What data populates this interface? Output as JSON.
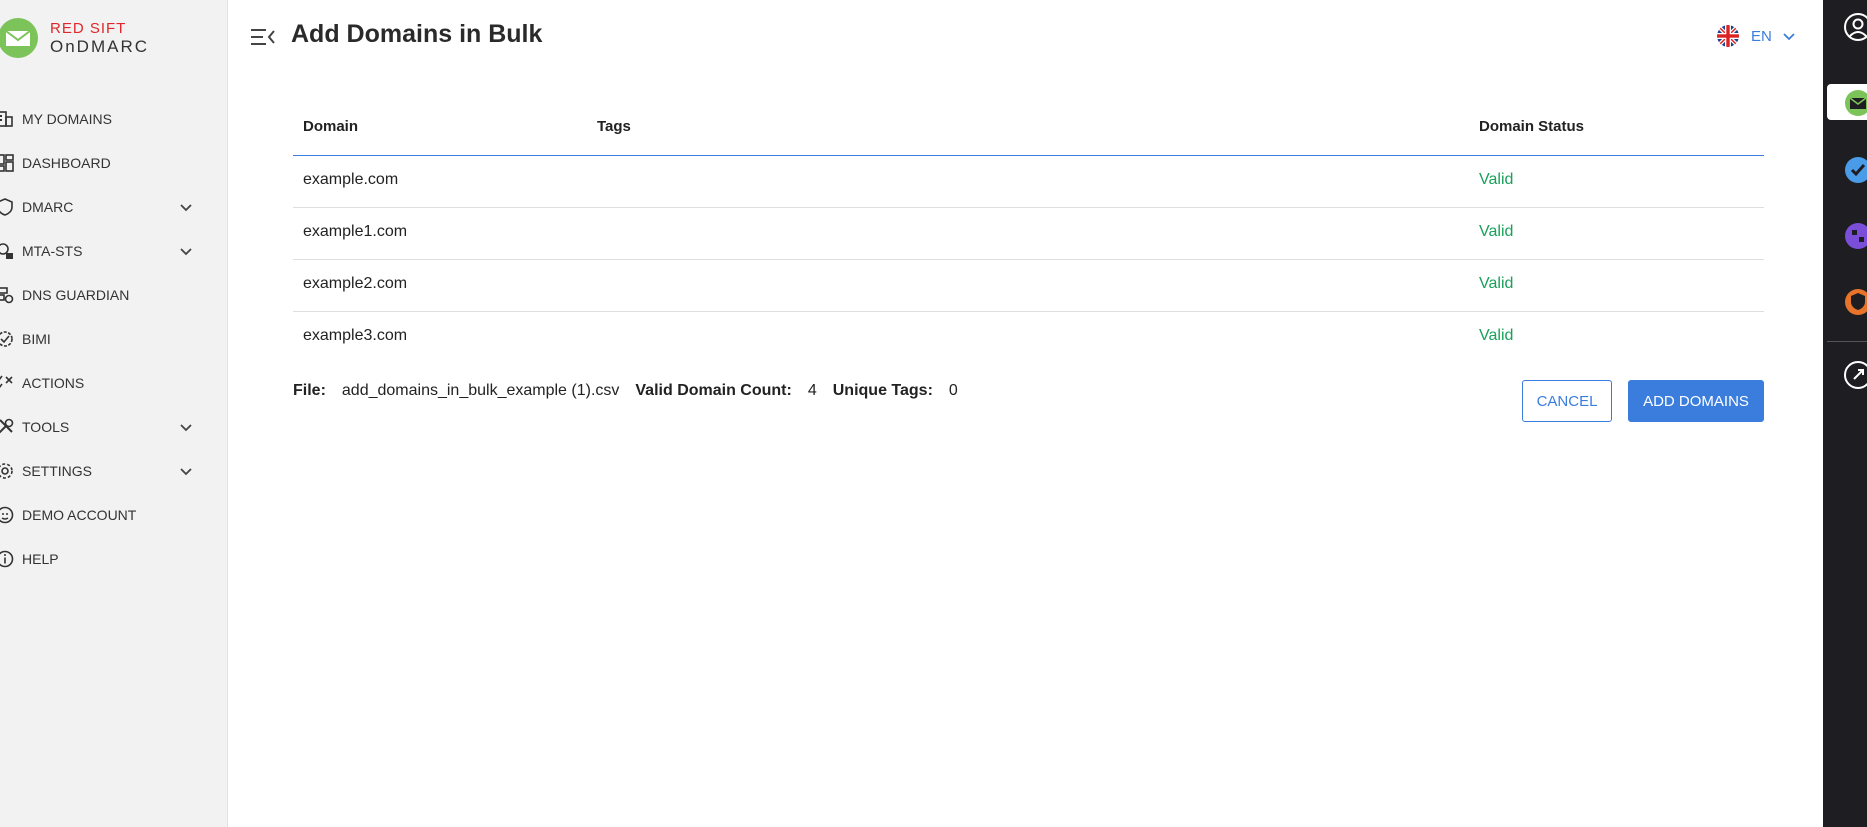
{
  "brand": {
    "line1": "RED SIFT",
    "line2": "OnDMARC"
  },
  "sidebar": {
    "items": [
      {
        "label": "MY DOMAINS",
        "icon": "building-icon",
        "expandable": false
      },
      {
        "label": "DASHBOARD",
        "icon": "dashboard-icon",
        "expandable": false
      },
      {
        "label": "DMARC",
        "icon": "shield-icon",
        "expandable": true
      },
      {
        "label": "MTA-STS",
        "icon": "network-lock-icon",
        "expandable": true
      },
      {
        "label": "DNS GUARDIAN",
        "icon": "dns-guardian-icon",
        "expandable": false
      },
      {
        "label": "BIMI",
        "icon": "badge-icon",
        "expandable": false
      },
      {
        "label": "ACTIONS",
        "icon": "checklist-icon",
        "expandable": false
      },
      {
        "label": "TOOLS",
        "icon": "tools-icon",
        "expandable": true
      },
      {
        "label": "SETTINGS",
        "icon": "gear-icon",
        "expandable": true
      },
      {
        "label": "DEMO ACCOUNT",
        "icon": "account-icon",
        "expandable": false
      },
      {
        "label": "HELP",
        "icon": "info-icon",
        "expandable": false
      }
    ]
  },
  "header": {
    "title": "Add Domains in Bulk",
    "language": "EN"
  },
  "table": {
    "columns": {
      "domain": "Domain",
      "tags": "Tags",
      "status": "Domain Status"
    },
    "rows": [
      {
        "domain": "example.com",
        "tags": "",
        "status": "Valid"
      },
      {
        "domain": "example1.com",
        "tags": "",
        "status": "Valid"
      },
      {
        "domain": "example2.com",
        "tags": "",
        "status": "Valid"
      },
      {
        "domain": "example3.com",
        "tags": "",
        "status": "Valid"
      }
    ]
  },
  "summary": {
    "file_label": "File:",
    "file_name": "add_domains_in_bulk_example (1).csv",
    "valid_count_label": "Valid Domain Count:",
    "valid_count": "4",
    "unique_tags_label": "Unique Tags:",
    "unique_tags": "0"
  },
  "actions": {
    "cancel": "CANCEL",
    "add": "ADD DOMAINS"
  },
  "colors": {
    "accent": "#3b7ddd",
    "valid": "#1aa05a",
    "brand_red": "#e0262a",
    "rail": "#1e1e22"
  }
}
